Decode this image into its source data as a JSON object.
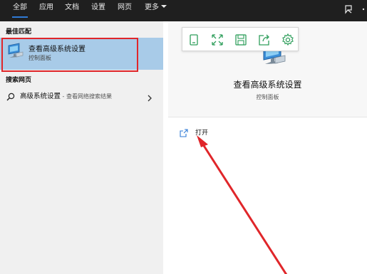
{
  "tabs": [
    {
      "label": "全部",
      "active": true
    },
    {
      "label": "应用",
      "active": false
    },
    {
      "label": "文档",
      "active": false
    },
    {
      "label": "设置",
      "active": false
    },
    {
      "label": "网页",
      "active": false
    },
    {
      "label": "更多",
      "active": false,
      "has_dropdown": true
    }
  ],
  "topbar_icons": [
    "feedback-icon",
    "more-options-icon"
  ],
  "left": {
    "best_match_title": "最佳匹配",
    "best_match_item": {
      "title": "查看高级系统设置",
      "subtitle": "控制面板",
      "icon": "system-settings-monitor-icon"
    },
    "web_title": "搜索网页",
    "web_item": {
      "query": "高级系统设置",
      "suffix": " - 查看网络搜索结果",
      "icon": "search-icon"
    }
  },
  "right": {
    "title": "查看高级系统设置",
    "subtitle": "控制面板",
    "toolbar_icons": [
      "tablet-icon",
      "expand-icon",
      "save-icon",
      "share-icon",
      "settings-icon"
    ],
    "action_open": {
      "label": "打开",
      "icon": "open-icon"
    }
  },
  "colors": {
    "topbar": "#1f1f1f",
    "tab_underline": "#2f7ad6",
    "selected_bg": "#a8cbe8",
    "highlight_red": "#e0262a",
    "toolbar_green": "#2e9e5b"
  }
}
